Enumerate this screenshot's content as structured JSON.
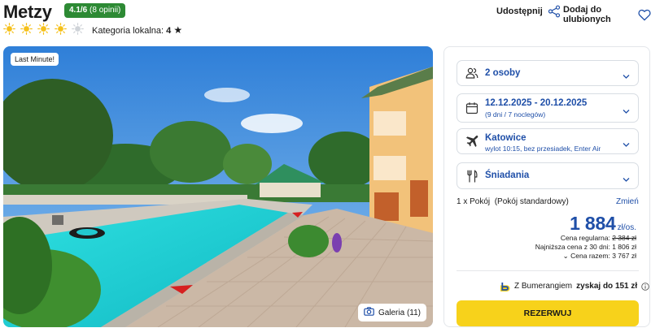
{
  "hotel": {
    "name": "Metzy",
    "rating": "4.1/6",
    "reviews": "(8 opinii)",
    "sun_rating": 4,
    "sun_max": 5,
    "category_label": "Kategoria lokalna:",
    "category_value": "4"
  },
  "actions": {
    "share_label": "Udostępnij",
    "favorite_label": "Dodaj do ulubionych"
  },
  "photo": {
    "badge": "Last Minute!",
    "gallery_label": "Galeria (11)"
  },
  "booking": {
    "guests": "2 osoby",
    "dates": "12.12.2025 - 20.12.2025",
    "dates_sub": "(9 dni / 7 noclegów)",
    "departure_city": "Katowice",
    "departure_sub": "wylot 10:15, bez przesiadek, Enter Air",
    "board": "Śniadania",
    "room_count": "1 x Pokój",
    "room_type": "(Pokój standardowy)",
    "change_label": "Zmień",
    "price": "1 884",
    "price_unit": "zł/os.",
    "regular_label": "Cena regularna:",
    "regular_price": "2 384 zł",
    "lowest30_label": "Najniższa cena z 30 dni:",
    "lowest30_price": "1 806 zł",
    "total_label": "Cena razem:",
    "total_price": "3 767 zł",
    "bumerang_prefix": "Z Bumerangiem",
    "bumerang_bold": "zyskaj do 151 zł",
    "reserve_label": "REZERWUJ"
  },
  "colors": {
    "accent_blue": "#1f4fa8",
    "rating_green": "#2d8a34",
    "reserve_yellow": "#f7d21b",
    "sun_yellow": "#f5c01a"
  }
}
